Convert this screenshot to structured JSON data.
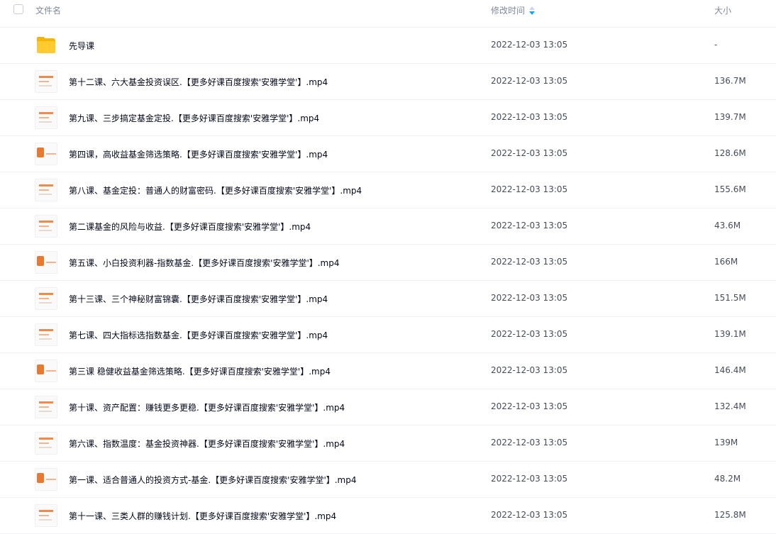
{
  "header": {
    "name_label": "文件名",
    "time_label": "修改时间",
    "size_label": "大小"
  },
  "rows": [
    {
      "name": "先导课",
      "time": "2022-12-03 13:05",
      "size": "-",
      "icon": "folder-icon"
    },
    {
      "name": "第十二课、六大基金投资误区.【更多好课百度搜索'安雅学堂'】.mp4",
      "time": "2022-12-03 13:05",
      "size": "136.7M",
      "icon": "video-thumbnail"
    },
    {
      "name": "第九课、三步搞定基金定投.【更多好课百度搜索'安雅学堂'】.mp4",
      "time": "2022-12-03 13:05",
      "size": "139.7M",
      "icon": "video-thumbnail"
    },
    {
      "name": "第四课，高收益基金筛选策略.【更多好课百度搜索'安雅学堂'】.mp4",
      "time": "2022-12-03 13:05",
      "size": "128.6M",
      "icon": "video-thumbnail"
    },
    {
      "name": "第八课、基金定投：普通人的财富密码.【更多好课百度搜索'安雅学堂'】.mp4",
      "time": "2022-12-03 13:05",
      "size": "155.6M",
      "icon": "video-thumbnail"
    },
    {
      "name": "第二课基金的风险与收益.【更多好课百度搜索'安雅学堂'】.mp4",
      "time": "2022-12-03 13:05",
      "size": "43.6M",
      "icon": "video-thumbnail"
    },
    {
      "name": "第五课、小白投资利器-指数基金.【更多好课百度搜索'安雅学堂'】.mp4",
      "time": "2022-12-03 13:05",
      "size": "166M",
      "icon": "video-thumbnail"
    },
    {
      "name": "第十三课、三个神秘财富锦囊.【更多好课百度搜索'安雅学堂'】.mp4",
      "time": "2022-12-03 13:05",
      "size": "151.5M",
      "icon": "video-thumbnail"
    },
    {
      "name": "第七课、四大指标选指数基金.【更多好课百度搜索'安雅学堂'】.mp4",
      "time": "2022-12-03 13:05",
      "size": "139.1M",
      "icon": "video-thumbnail"
    },
    {
      "name": "第三课 稳健收益基金筛选策略.【更多好课百度搜索'安雅学堂'】.mp4",
      "time": "2022-12-03 13:05",
      "size": "146.4M",
      "icon": "video-thumbnail"
    },
    {
      "name": "第十课、资产配置：赚钱更多更稳.【更多好课百度搜索'安雅学堂'】.mp4",
      "time": "2022-12-03 13:05",
      "size": "132.4M",
      "icon": "video-thumbnail"
    },
    {
      "name": "第六课、指数温度：基金投资神器.【更多好课百度搜索'安雅学堂'】.mp4",
      "time": "2022-12-03 13:05",
      "size": "139M",
      "icon": "video-thumbnail"
    },
    {
      "name": "第一课、适合普通人的投资方式-基金.【更多好课百度搜索'安雅学堂'】.mp4",
      "time": "2022-12-03 13:05",
      "size": "48.2M",
      "icon": "video-thumbnail"
    },
    {
      "name": "第十一课、三类人群的赚钱计划.【更多好课百度搜索'安雅学堂'】.mp4",
      "time": "2022-12-03 13:05",
      "size": "125.8M",
      "icon": "video-thumbnail"
    }
  ],
  "colors": {
    "sort_active": "#06a7ff",
    "sort_inactive": "#c4d7ff",
    "folder": "#f7b500"
  }
}
